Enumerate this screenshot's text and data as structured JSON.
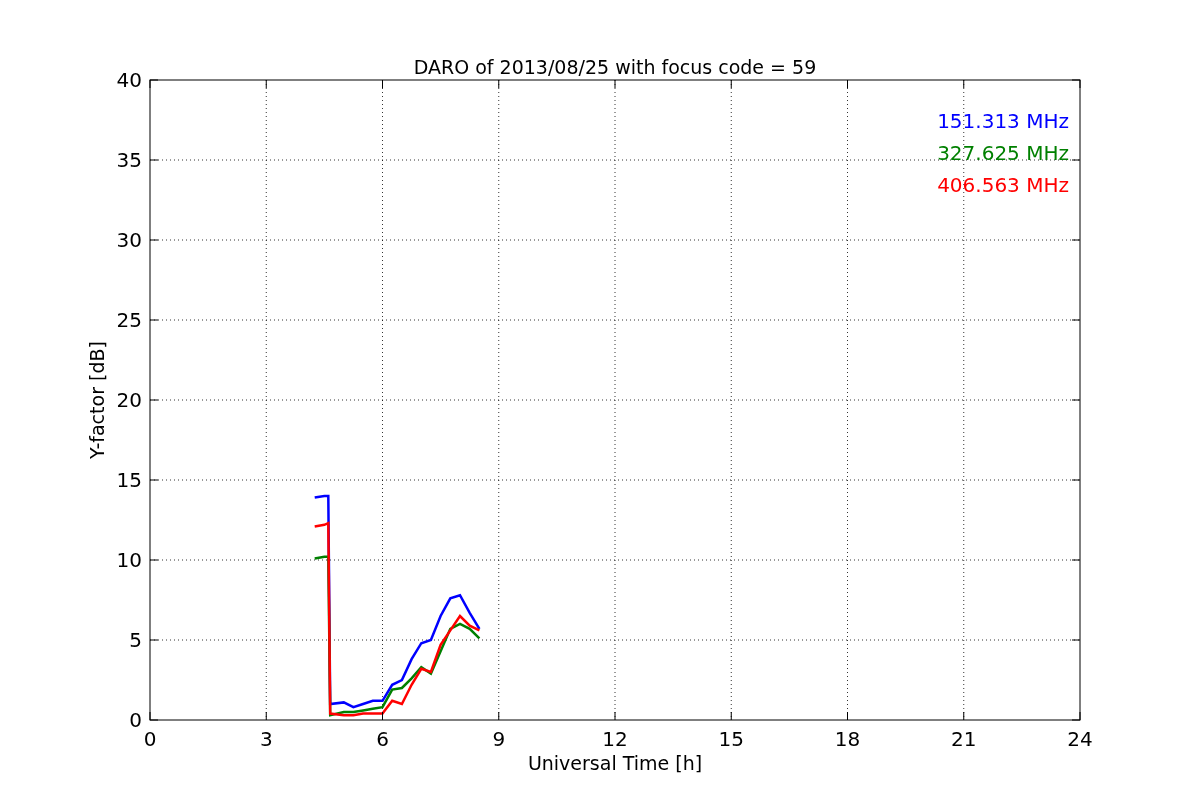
{
  "chart_data": {
    "type": "line",
    "title": "DARO of 2013/08/25 with focus code = 59",
    "xlabel": "Universal Time [h]",
    "ylabel": "Y-factor [dB]",
    "x": [
      4.25,
      4.5,
      4.6,
      4.65,
      5.0,
      5.25,
      5.5,
      5.75,
      6.0,
      6.25,
      6.5,
      6.75,
      7.0,
      7.25,
      7.5,
      7.75,
      8.0,
      8.25,
      8.5
    ],
    "series": [
      {
        "name": "151.313 MHz",
        "color": "#0000ff",
        "values": [
          13.9,
          14.0,
          14.0,
          1.0,
          1.1,
          0.8,
          1.0,
          1.2,
          1.2,
          2.2,
          2.5,
          3.8,
          4.8,
          5.0,
          6.5,
          7.6,
          7.8,
          6.7,
          5.7
        ]
      },
      {
        "name": "327.625 MHz",
        "color": "#008000",
        "values": [
          10.1,
          10.2,
          10.2,
          0.3,
          0.5,
          0.5,
          0.6,
          0.7,
          0.8,
          1.9,
          2.0,
          2.6,
          3.3,
          2.9,
          4.3,
          5.7,
          6.0,
          5.7,
          5.1
        ]
      },
      {
        "name": "406.563 MHz",
        "color": "#ff0000",
        "values": [
          12.1,
          12.2,
          12.3,
          0.4,
          0.3,
          0.3,
          0.4,
          0.4,
          0.4,
          1.2,
          1.0,
          2.2,
          3.2,
          3.0,
          4.7,
          5.6,
          6.5,
          5.9,
          5.6
        ]
      }
    ],
    "xlim": [
      0,
      24
    ],
    "ylim": [
      0,
      40
    ],
    "xticks": [
      0,
      3,
      6,
      9,
      12,
      15,
      18,
      21,
      24
    ],
    "yticks": [
      0,
      5,
      10,
      15,
      20,
      25,
      30,
      35,
      40
    ],
    "grid": true
  }
}
